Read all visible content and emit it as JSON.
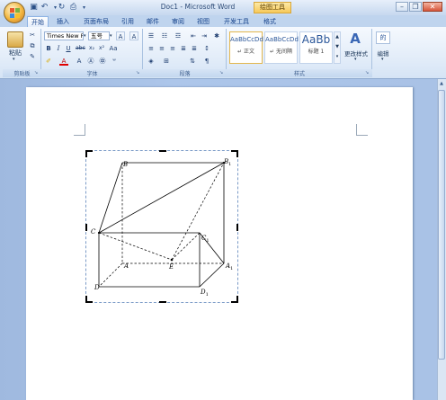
{
  "window": {
    "title": "Doc1 - Microsoft Word",
    "contextual_tab": "绘图工具"
  },
  "tabs": [
    "开始",
    "插入",
    "页面布局",
    "引用",
    "邮件",
    "审阅",
    "视图",
    "开发工具",
    "格式"
  ],
  "ribbon": {
    "clipboard": {
      "paste_label": "粘贴",
      "group_label": "剪贴板"
    },
    "font": {
      "font_name": "Times New R",
      "font_size": "五号",
      "group_label": "字体"
    },
    "paragraph": {
      "group_label": "段落"
    },
    "styles": {
      "group_label": "样式",
      "items": [
        {
          "sample": "AaBbCcDd",
          "name": "↵ 正文"
        },
        {
          "sample": "AaBbCcDd",
          "name": "↵ 无间隔"
        },
        {
          "sample": "AaBb",
          "name": "标题 1"
        }
      ],
      "change_styles_label": "更改样式"
    },
    "editing": {
      "label": "编辑"
    }
  },
  "figure": {
    "labels": {
      "B": "B",
      "B1": "B",
      "B1_sub": "1",
      "C": "C",
      "C1": "C",
      "C1_sub": "1",
      "A": "A",
      "A1": "A",
      "A1_sub": "1",
      "E": "E",
      "D": "D",
      "D1": "D",
      "D1_sub": "1"
    }
  }
}
